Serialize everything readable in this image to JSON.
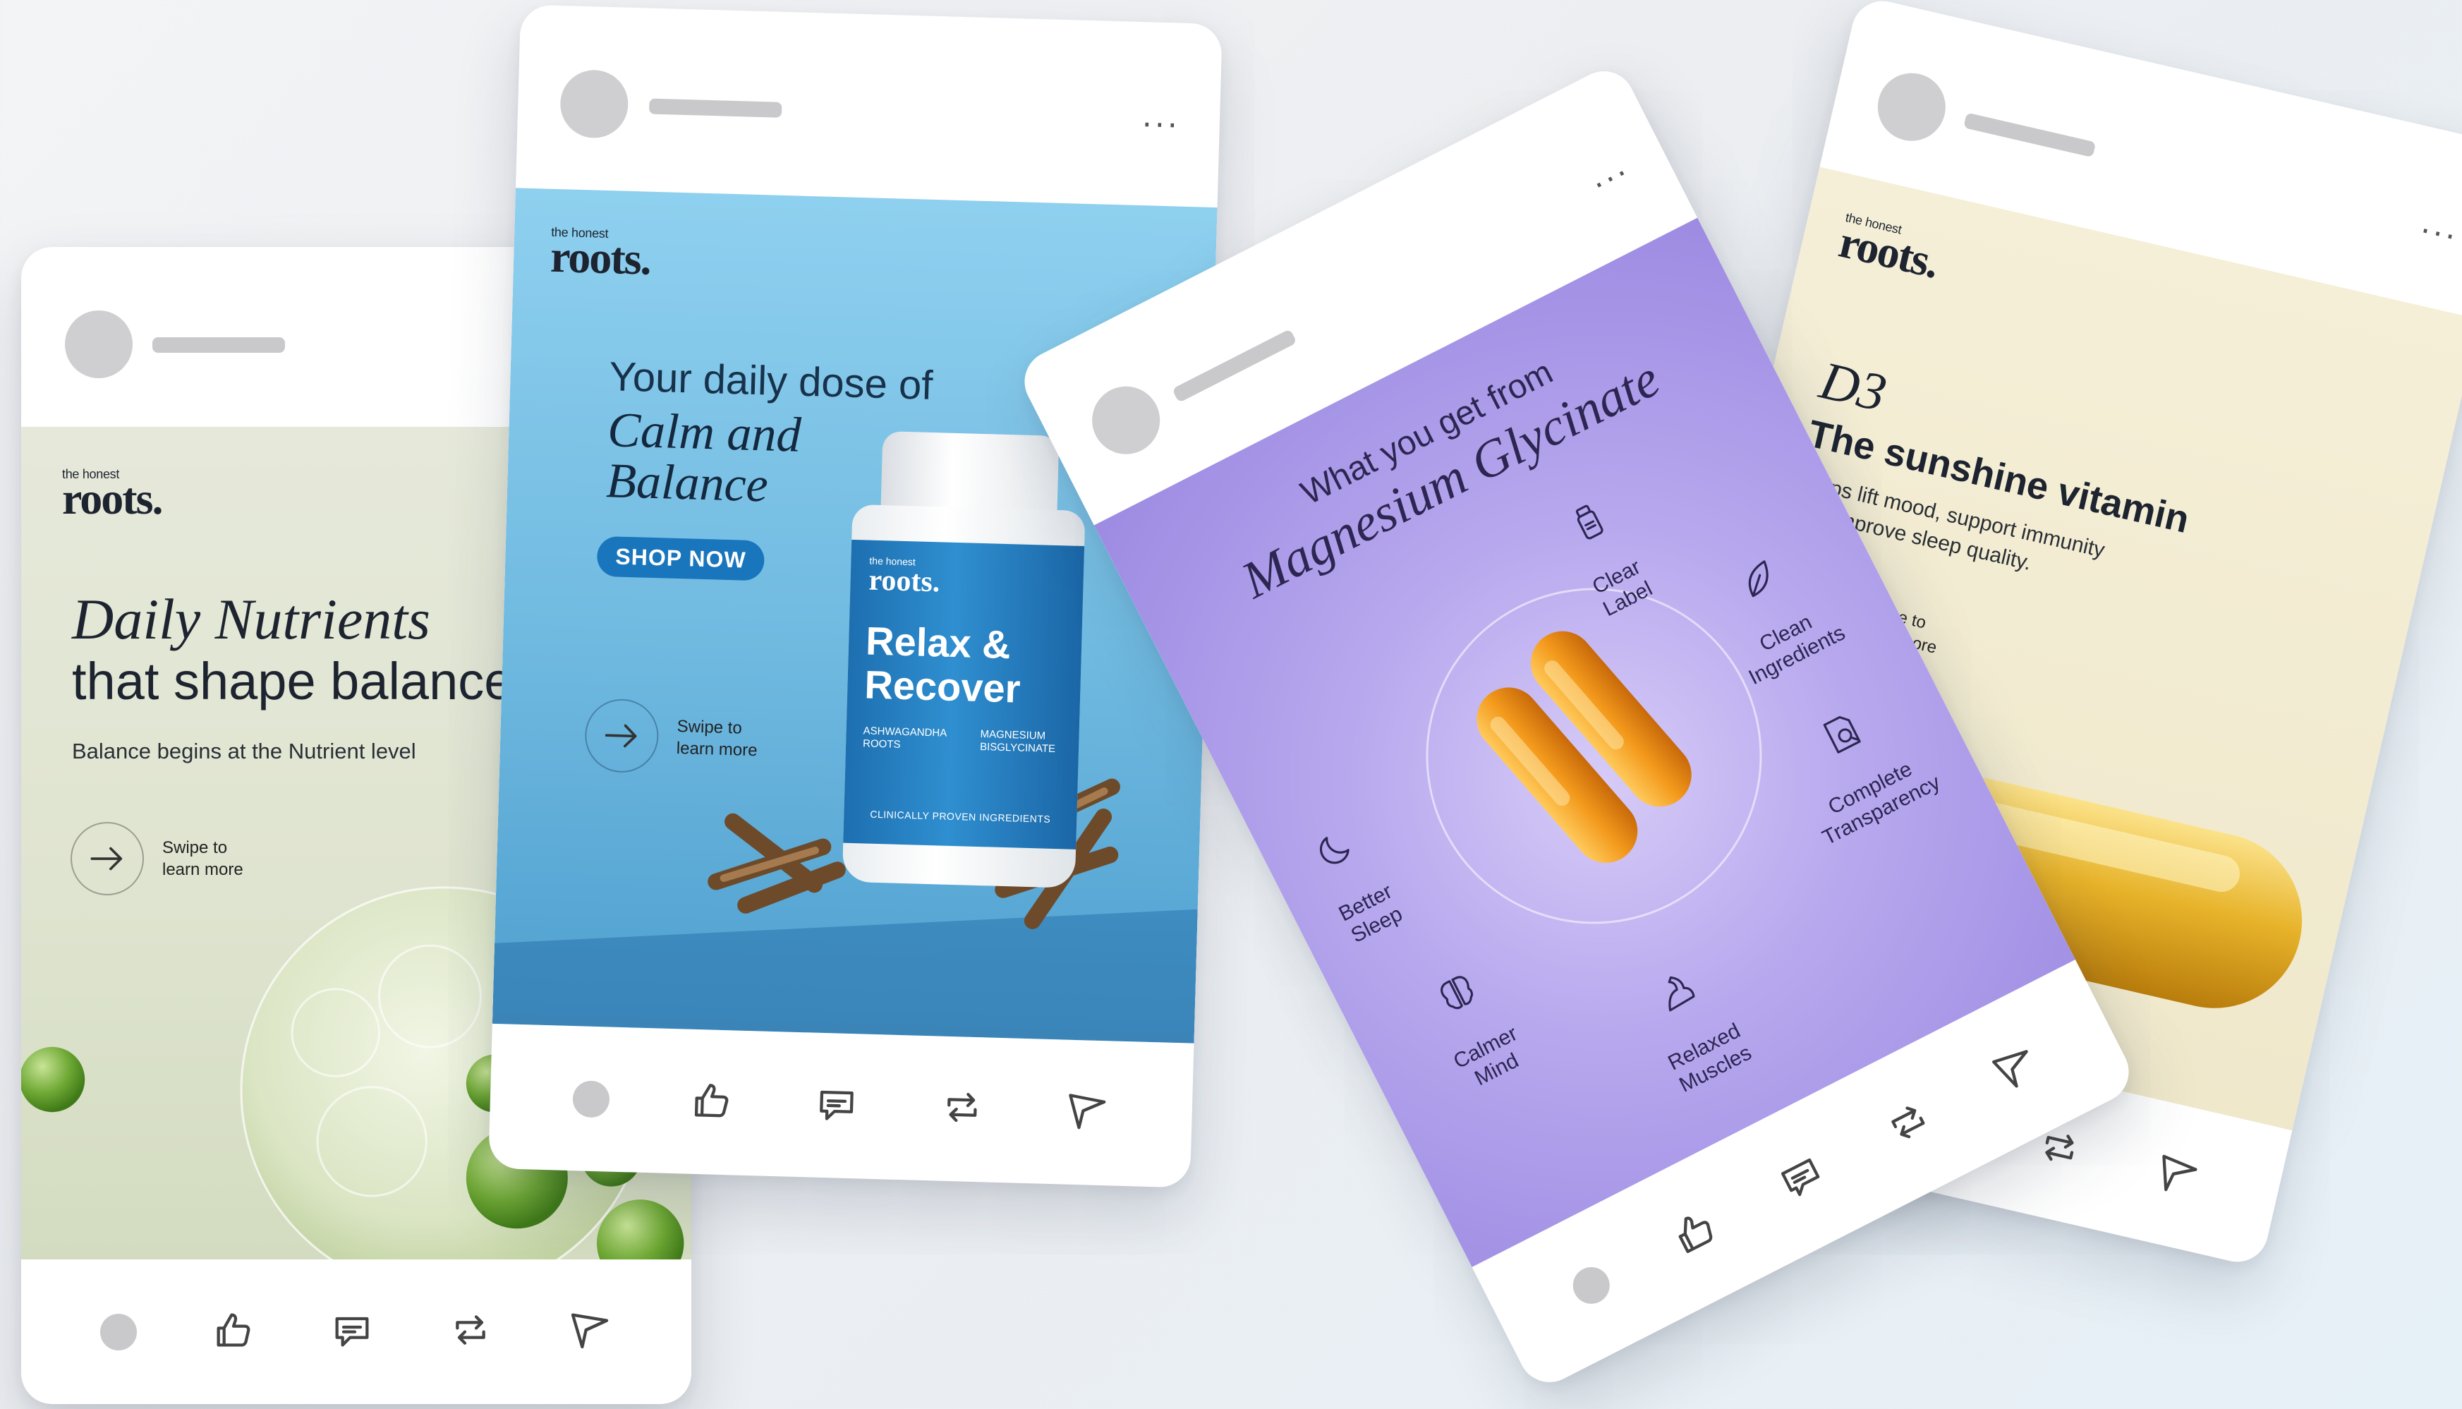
{
  "cards": [
    {
      "brand_small": "the honest",
      "brand_name": "roots.",
      "headline_italic": "Daily Nutrients",
      "headline_regular": "that shape balance",
      "subtitle": "Balance begins at the Nutrient level",
      "swipe": "Swipe to\nlearn more",
      "bg_color": "#e3e7d6"
    },
    {
      "brand_small": "the honest",
      "brand_name": "roots.",
      "headline_top": "Your daily dose of",
      "headline_italic_1": "Calm and",
      "headline_italic_2": "Balance",
      "cta": "SHOP NOW",
      "swipe": "Swipe to\nlearn more",
      "bottle": {
        "brand_small": "the honest",
        "brand_name": "roots.",
        "title_1": "Relax &",
        "title_2": "Recover",
        "ingredient_1": "ASHWAGANDHA\nROOTS",
        "ingredient_2": "MAGNESIUM\nBISGLYCINATE",
        "strip": "CLINICALLY PROVEN INGREDIENTS"
      },
      "bg_color": "#7ec3e6"
    },
    {
      "headline_top": "What you get from",
      "headline_italic": "Magnesium Glycinate",
      "benefits": [
        {
          "label": "Clear\nLabel",
          "icon": "bottle-icon"
        },
        {
          "label": "Clean\nIngredients",
          "icon": "leaf-icon"
        },
        {
          "label": "Complete\nTransparency",
          "icon": "magnifier-document-icon"
        },
        {
          "label": "Relaxed\nMuscles",
          "icon": "flexed-arm-icon"
        },
        {
          "label": "Calmer\nMind",
          "icon": "brain-icon"
        },
        {
          "label": "Better\nSleep",
          "icon": "moon-icon"
        }
      ],
      "bg_color": "#b6a8ec"
    },
    {
      "brand_small": "the honest",
      "brand_name": "roots.",
      "d3": "D3",
      "headline": "The sunshine vitamin",
      "subtitle": "Helps lift mood, support immunity\nand improve sleep quality.",
      "swipe": "Swipe to\nlearn more",
      "bg_color": "#f2ecd2"
    }
  ],
  "footer_actions": [
    "like",
    "comment",
    "repost",
    "send"
  ],
  "more_label": "...",
  "colors": {
    "accent_blue": "#1976bd",
    "capsule_orange": "#f39a1c",
    "softgel_gold": "#e7b32a"
  }
}
